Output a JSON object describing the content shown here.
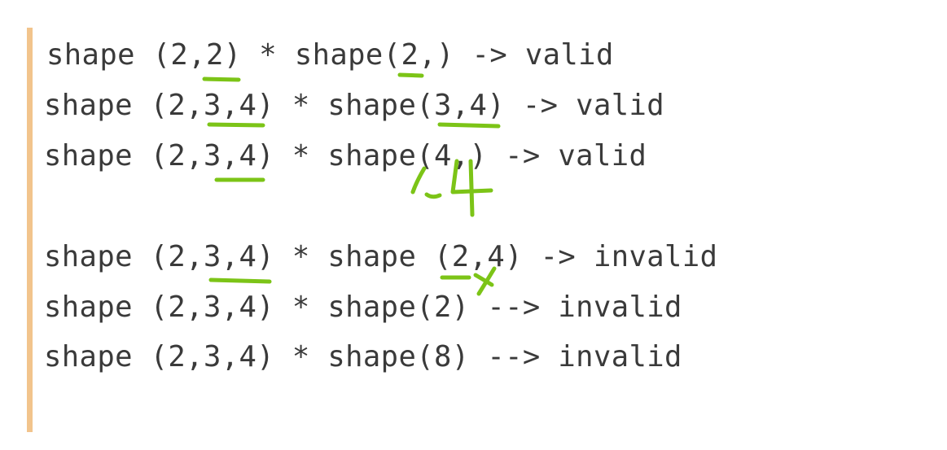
{
  "colors": {
    "background": "#ffffff",
    "quote_bar": "#f2c48c",
    "code_text": "#3a3a3a",
    "annotation_ink": "#7cc417"
  },
  "code_lines": [
    "shape (2,2) * shape(2,) -> valid",
    "shape (2,3,4) * shape(3,4) -> valid",
    "shape (2,3,4) * shape(4,) -> valid",
    "shape (2,3,4) * shape (2,4) -> invalid",
    "shape (2,3,4) * shape(2) --> invalid",
    "shape (2,3,4) * shape(8) --> invalid"
  ],
  "annotations": {
    "handwritten_dims": ",4"
  }
}
